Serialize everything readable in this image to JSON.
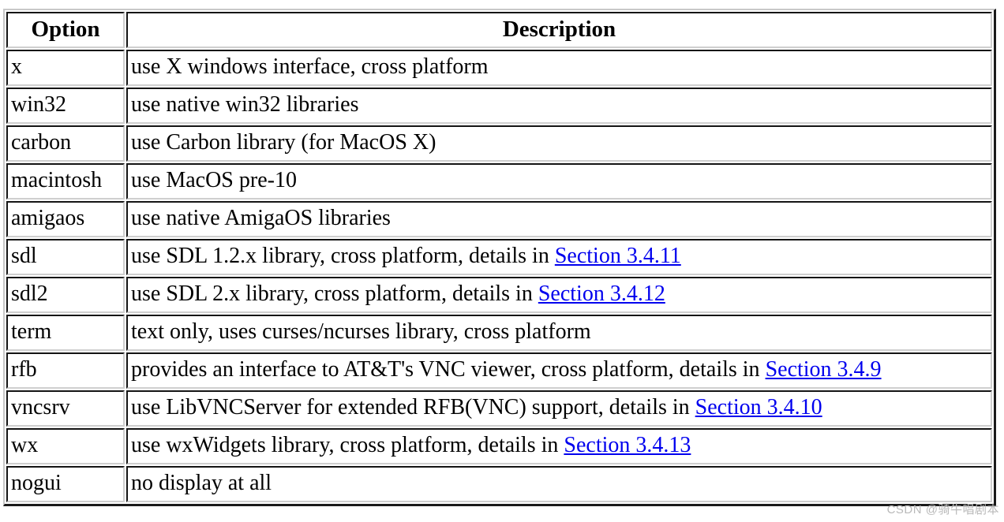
{
  "table": {
    "headers": {
      "option": "Option",
      "description": "Description"
    },
    "rows": [
      {
        "option": "x",
        "desc_before": "use X windows interface, cross platform",
        "link": null,
        "desc_after": ""
      },
      {
        "option": "win32",
        "desc_before": "use native win32 libraries",
        "link": null,
        "desc_after": ""
      },
      {
        "option": "carbon",
        "desc_before": "use Carbon library (for MacOS X)",
        "link": null,
        "desc_after": ""
      },
      {
        "option": "macintosh",
        "desc_before": "use MacOS pre-10",
        "link": null,
        "desc_after": ""
      },
      {
        "option": "amigaos",
        "desc_before": "use native AmigaOS libraries",
        "link": null,
        "desc_after": ""
      },
      {
        "option": "sdl",
        "desc_before": "use SDL 1.2.x library, cross platform, details in ",
        "link": "Section 3.4.11",
        "desc_after": ""
      },
      {
        "option": "sdl2",
        "desc_before": "use SDL 2.x library, cross platform, details in ",
        "link": "Section 3.4.12",
        "desc_after": ""
      },
      {
        "option": "term",
        "desc_before": "text only, uses curses/ncurses library, cross platform",
        "link": null,
        "desc_after": ""
      },
      {
        "option": "rfb",
        "desc_before": "provides an interface to AT&T's VNC viewer, cross platform, details in ",
        "link": "Section 3.4.9",
        "desc_after": ""
      },
      {
        "option": "vncsrv",
        "desc_before": "use LibVNCServer for extended RFB(VNC) support, details in ",
        "link": "Section 3.4.10",
        "desc_after": ""
      },
      {
        "option": "wx",
        "desc_before": "use wxWidgets library, cross platform, details in ",
        "link": "Section 3.4.13",
        "desc_after": ""
      },
      {
        "option": "nogui",
        "desc_before": "no display at all",
        "link": null,
        "desc_after": ""
      }
    ]
  },
  "watermark": {
    "text": "CSDN @骑牛唱剧本"
  },
  "colors": {
    "link": "#0000ee",
    "text": "#000000",
    "cell_border_dark": "#141414",
    "cell_border_light": "#cfcfcf",
    "background": "#ffffff"
  }
}
